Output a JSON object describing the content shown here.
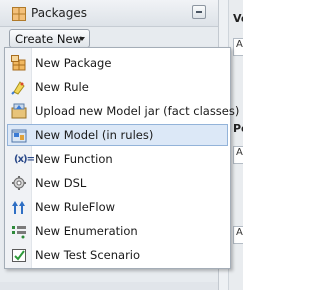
{
  "panel": {
    "title": "Packages",
    "create_button_label": "Create New"
  },
  "right_pane": {
    "fragments": [
      "Ve",
      "A",
      "Po",
      "A",
      "A"
    ]
  },
  "menu": {
    "items": [
      {
        "label": "New Package",
        "icon": "package-icon"
      },
      {
        "label": "New Rule",
        "icon": "rule-icon"
      },
      {
        "label": "Upload new Model jar (fact classes)",
        "icon": "upload-model-jar-icon"
      },
      {
        "label": "New Model (in rules)",
        "icon": "model-icon",
        "selected": true
      },
      {
        "label": "New Function",
        "icon": "function-icon"
      },
      {
        "label": "New DSL",
        "icon": "dsl-icon"
      },
      {
        "label": "New RuleFlow",
        "icon": "ruleflow-icon"
      },
      {
        "label": "New Enumeration",
        "icon": "enumeration-icon"
      },
      {
        "label": "New Test Scenario",
        "icon": "test-scenario-icon"
      }
    ]
  },
  "colors": {
    "selected_bg": "#dce8f7",
    "selected_border": "#93b3d9",
    "menu_border": "#a4adb7"
  }
}
